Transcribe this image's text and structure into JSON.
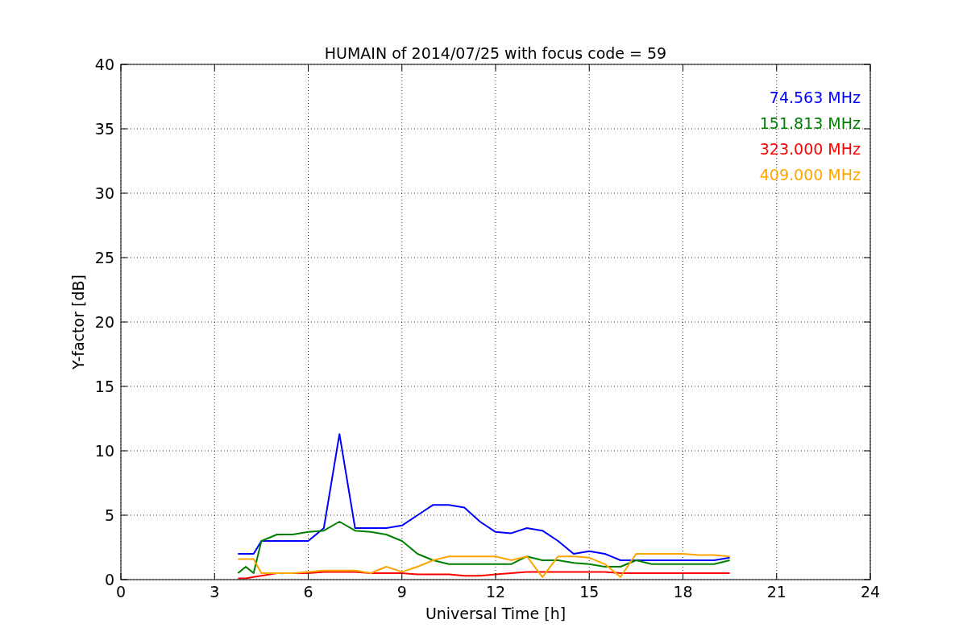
{
  "chart_data": {
    "type": "line",
    "title": "HUMAIN of 2014/07/25 with focus code = 59",
    "xlabel": "Universal Time [h]",
    "ylabel": "Y-factor [dB]",
    "x": [
      3.75,
      4,
      4.25,
      4.5,
      5,
      5.5,
      6,
      6.5,
      7,
      7.5,
      8,
      8.5,
      9,
      9.5,
      10,
      10.5,
      11,
      11.5,
      12,
      12.5,
      13,
      13.5,
      14,
      14.5,
      15,
      15.5,
      16,
      16.5,
      17,
      17.5,
      18,
      18.5,
      19,
      19.5
    ],
    "series": [
      {
        "name": "74.563 MHz",
        "color": "#0000ff",
        "values": [
          2,
          2,
          2,
          3,
          3,
          3,
          3,
          4,
          11.3,
          4,
          4,
          4,
          4.2,
          5,
          5.8,
          5.8,
          5.6,
          4.5,
          3.7,
          3.6,
          4,
          3.8,
          3,
          2,
          2.2,
          2,
          1.5,
          1.5,
          1.5,
          1.5,
          1.5,
          1.5,
          1.5,
          1.7
        ]
      },
      {
        "name": "151.813 MHz",
        "color": "#008000",
        "values": [
          0.5,
          1,
          0.5,
          3,
          3.5,
          3.5,
          3.7,
          3.8,
          4.5,
          3.8,
          3.7,
          3.5,
          3,
          2,
          1.5,
          1.2,
          1.2,
          1.2,
          1.2,
          1.2,
          1.8,
          1.5,
          1.5,
          1.3,
          1.2,
          1,
          1,
          1.5,
          1.2,
          1.2,
          1.2,
          1.2,
          1.2,
          1.5
        ]
      },
      {
        "name": "323.000 MHz",
        "color": "#ff0000",
        "values": [
          0.1,
          0.1,
          0.2,
          0.3,
          0.5,
          0.5,
          0.5,
          0.6,
          0.6,
          0.6,
          0.5,
          0.5,
          0.5,
          0.4,
          0.4,
          0.4,
          0.3,
          0.3,
          0.4,
          0.5,
          0.6,
          0.6,
          0.6,
          0.6,
          0.6,
          0.6,
          0.5,
          0.5,
          0.5,
          0.5,
          0.5,
          0.5,
          0.5,
          0.5
        ]
      },
      {
        "name": "409.000 MHz",
        "color": "#ffa500",
        "values": [
          1.6,
          1.6,
          1.6,
          0.5,
          0.5,
          0.5,
          0.6,
          0.7,
          0.7,
          0.7,
          0.5,
          1,
          0.6,
          1,
          1.5,
          1.8,
          1.8,
          1.8,
          1.8,
          1.5,
          1.8,
          0.2,
          1.8,
          1.8,
          1.7,
          1.2,
          0.2,
          2,
          2,
          2,
          2,
          1.9,
          1.9,
          1.8
        ]
      }
    ],
    "xlim": [
      0,
      24
    ],
    "ylim": [
      0,
      40
    ],
    "xticks": [
      0,
      3,
      6,
      9,
      12,
      15,
      18,
      21,
      24
    ],
    "yticks": [
      0,
      5,
      10,
      15,
      20,
      25,
      30,
      35,
      40
    ],
    "grid": true
  }
}
